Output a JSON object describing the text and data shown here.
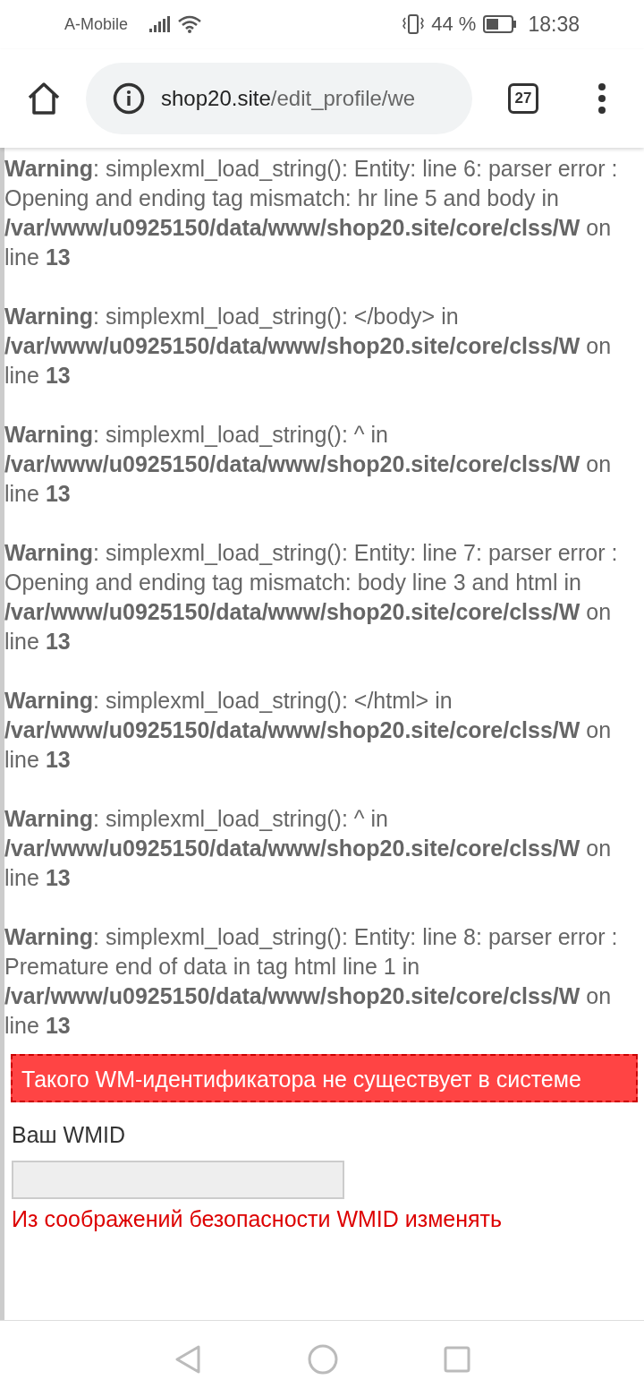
{
  "status_bar": {
    "carrier": "A-Mobile",
    "battery": "44 %",
    "time": "18:38"
  },
  "browser": {
    "url_host": "shop20.site",
    "url_path": "/edit_profile/we",
    "tab_count": "27"
  },
  "warnings": [
    {
      "text": "**Warning**: simplexml_load_string(): Entity: line 6: parser error : Opening and ending tag mismatch: hr line 5 and body in **/var/www/u0925150/data/www/shop20.site/core/clss/W** on line **13**"
    },
    {
      "text": "**Warning**: simplexml_load_string(): </body> in **/var/www/u0925150/data/www/shop20.site/core/clss/W** on line **13**"
    },
    {
      "text": "**Warning**: simplexml_load_string(): ^ in **/var/www/u0925150/data/www/shop20.site/core/clss/W** on line **13**"
    },
    {
      "text": "**Warning**: simplexml_load_string(): Entity: line 7: parser error : Opening and ending tag mismatch: body line 3 and html in **/var/www/u0925150/data/www/shop20.site/core/clss/W** on line **13**"
    },
    {
      "text": "**Warning**: simplexml_load_string(): </html> in **/var/www/u0925150/data/www/shop20.site/core/clss/W** on line **13**"
    },
    {
      "text": "**Warning**: simplexml_load_string(): ^ in **/var/www/u0925150/data/www/shop20.site/core/clss/W** on line **13**"
    },
    {
      "text": "**Warning**: simplexml_load_string(): Entity: line 8: parser error : Premature end of data in tag html line 1 in **/var/www/u0925150/data/www/shop20.site/core/clss/W** on line **13**"
    }
  ],
  "error_message": "Такого WM-идентификатора не существует в системе",
  "form": {
    "label": "Ваш WMID",
    "note": "Из соображений безопасности WMID изменять"
  }
}
